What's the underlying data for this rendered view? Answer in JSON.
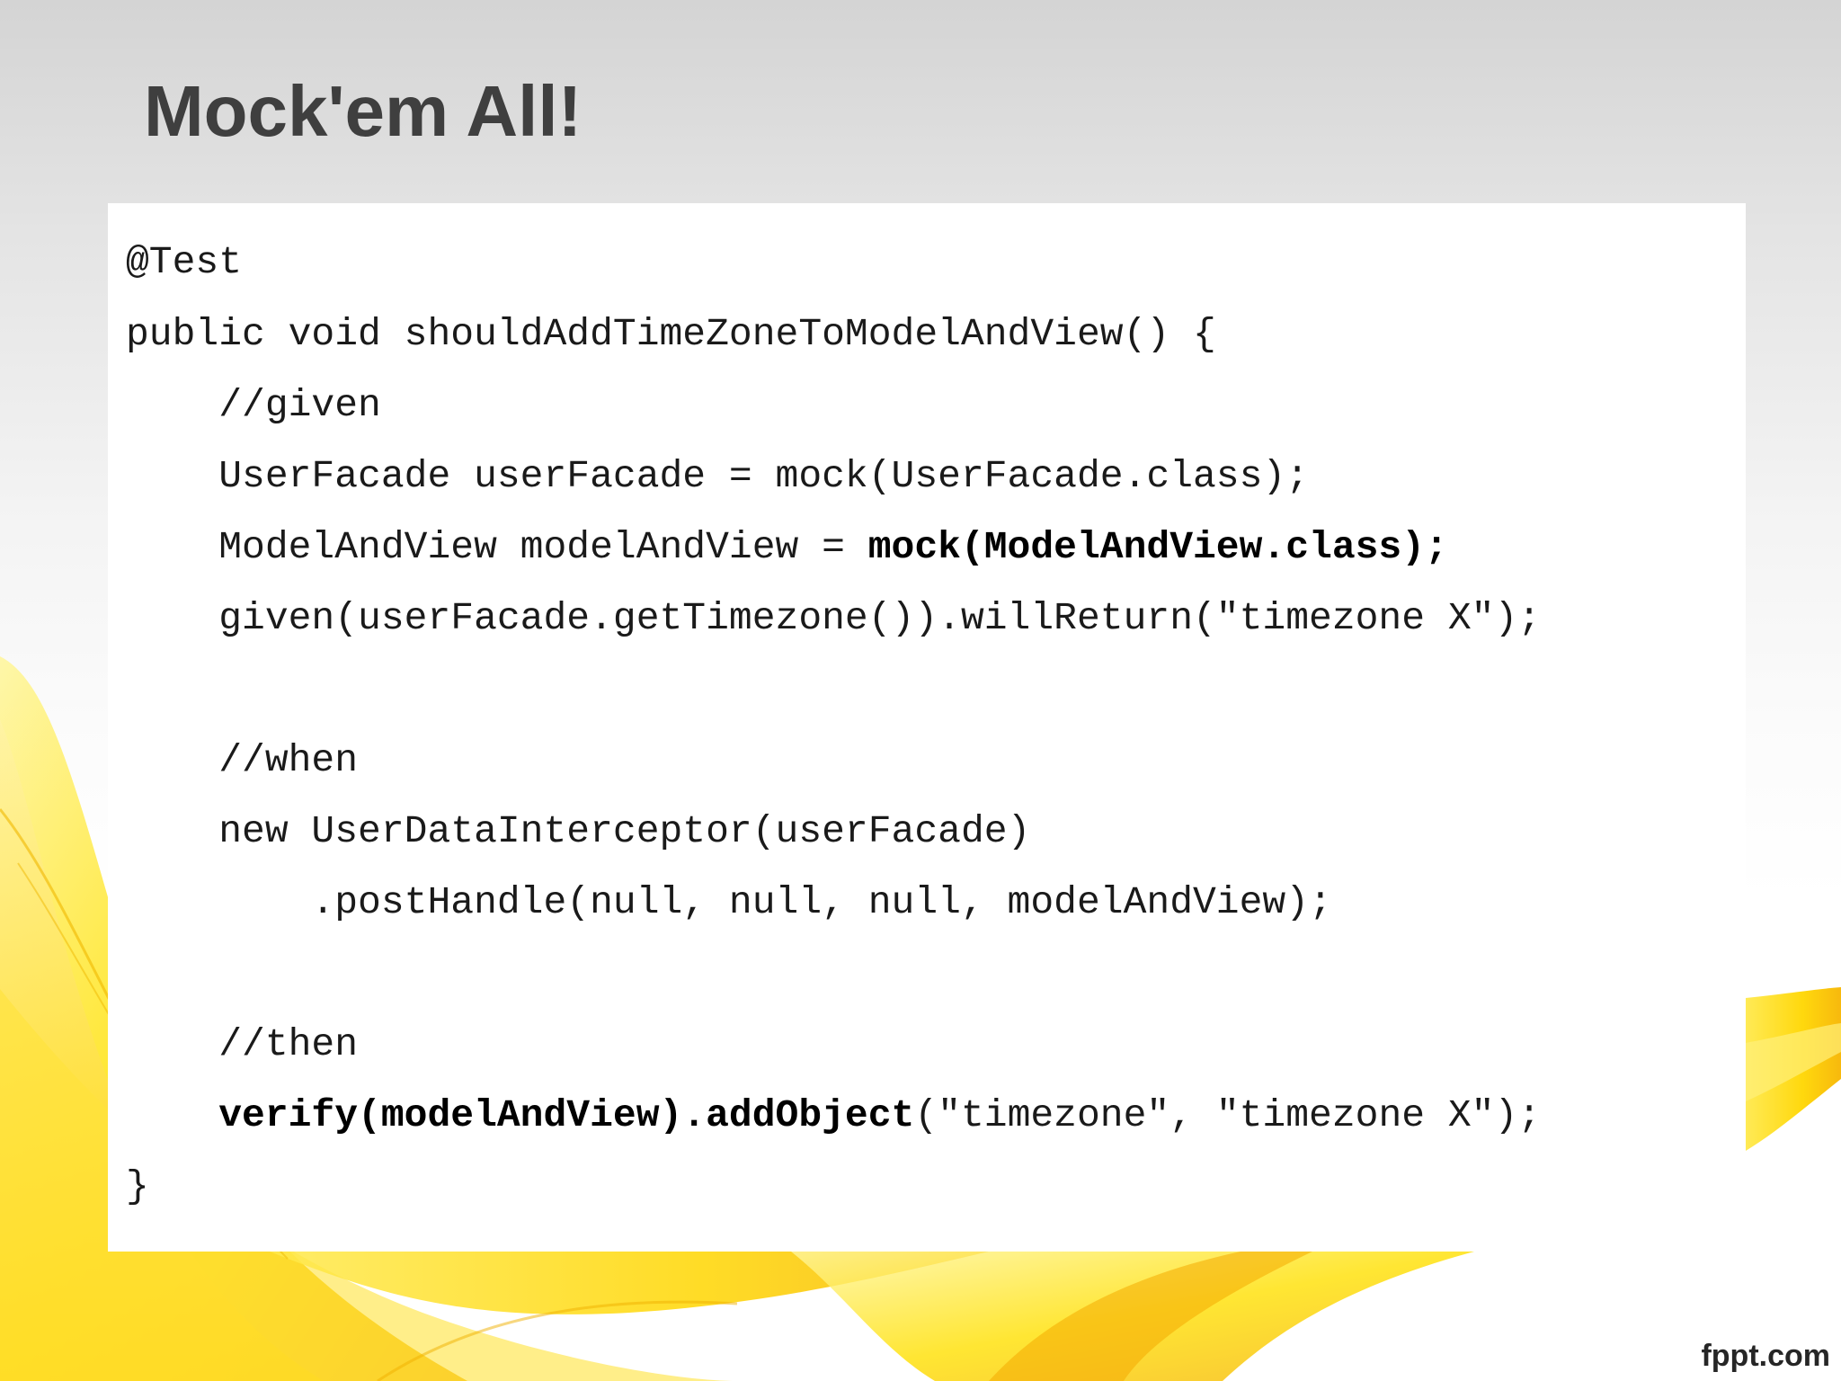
{
  "slide": {
    "title": "Mock'em All!",
    "footer_brand": "fppt.com"
  },
  "code": {
    "line1": "@Test",
    "line2": "public void shouldAddTimeZoneToModelAndView() {",
    "line3": "    //given",
    "line4": "    UserFacade userFacade = mock(UserFacade.class);",
    "line5_normal": "    ModelAndView modelAndView = ",
    "line5_bold": "mock(ModelAndView.class);",
    "line6": "    given(userFacade.getTimezone()).willReturn(\"timezone X\");",
    "line7": "    //when",
    "line8": "    new UserDataInterceptor(userFacade)",
    "line9": "        .postHandle(null, null, null, modelAndView);",
    "line10": "    //then",
    "line11_indent": "    ",
    "line11_bold": "verify(modelAndView).addObject",
    "line11_normal": "(\"timezone\", \"timezone X\");",
    "line12": "}"
  },
  "colors": {
    "title": "#3f3f3f",
    "code_text": "#1a1a1a",
    "ribbon_yellow": "#ffe200",
    "ribbon_orange": "#f6a800"
  }
}
